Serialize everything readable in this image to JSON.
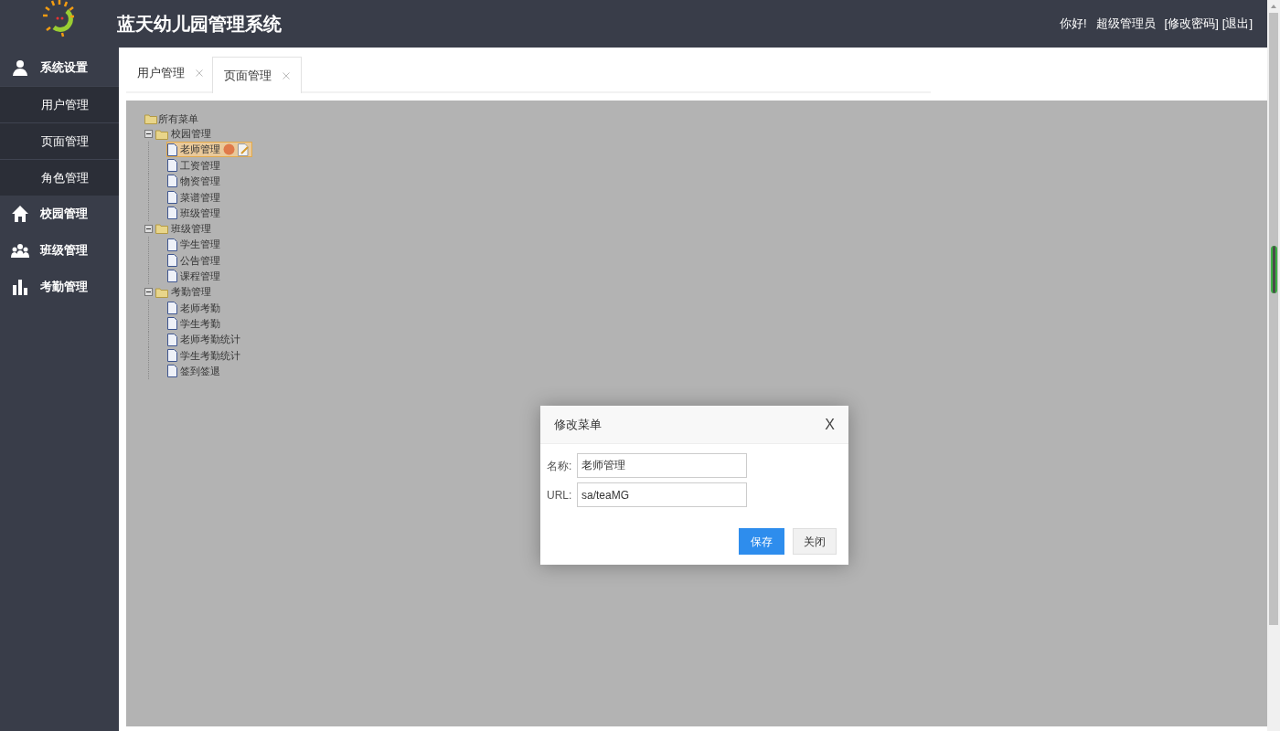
{
  "header": {
    "title": "蓝天幼儿园管理系统",
    "greeting": "你好!",
    "user": "超级管理员",
    "links": [
      "[修改密码]",
      "[退出]"
    ]
  },
  "sidebar": {
    "groups": [
      {
        "kind": "user",
        "label": "系统设置",
        "items": [
          "用户管理",
          "页面管理",
          "角色管理"
        ]
      },
      {
        "kind": "home",
        "label": "校园管理"
      },
      {
        "kind": "people",
        "label": "班级管理"
      },
      {
        "kind": "chart",
        "label": "考勤管理"
      }
    ]
  },
  "tabs": [
    {
      "label": "用户管理",
      "selected": false
    },
    {
      "label": "页面管理",
      "selected": true
    }
  ],
  "tree": {
    "label": "所有菜单",
    "children": [
      {
        "label": "校园管理",
        "expanded": true,
        "children": [
          {
            "label": "老师管理",
            "selected": true
          },
          {
            "label": "工资管理",
            "selected": false
          },
          {
            "label": "物资管理",
            "selected": false
          },
          {
            "label": "菜谱管理",
            "selected": false
          },
          {
            "label": "班级管理",
            "selected": false
          }
        ]
      },
      {
        "label": "班级管理",
        "expanded": true,
        "children": [
          {
            "label": "学生管理",
            "selected": false
          },
          {
            "label": "公告管理",
            "selected": false
          },
          {
            "label": "课程管理",
            "selected": false
          }
        ]
      },
      {
        "label": "考勤管理",
        "expanded": true,
        "children": [
          {
            "label": "老师考勤",
            "selected": false
          },
          {
            "label": "学生考勤",
            "selected": false
          },
          {
            "label": "老师考勤统计",
            "selected": false
          },
          {
            "label": "学生考勤统计",
            "selected": false
          },
          {
            "label": "签到签退",
            "selected": false
          }
        ]
      }
    ]
  },
  "dialog": {
    "title": "修改菜单",
    "close": "X",
    "fields": [
      {
        "label": "名称:",
        "value": "老师管理"
      },
      {
        "label": "URL:",
        "value": "sa/teaMG"
      }
    ],
    "buttons": [
      {
        "kind": "primary",
        "label": "保存"
      },
      {
        "kind": "default",
        "label": "关闭"
      }
    ]
  }
}
